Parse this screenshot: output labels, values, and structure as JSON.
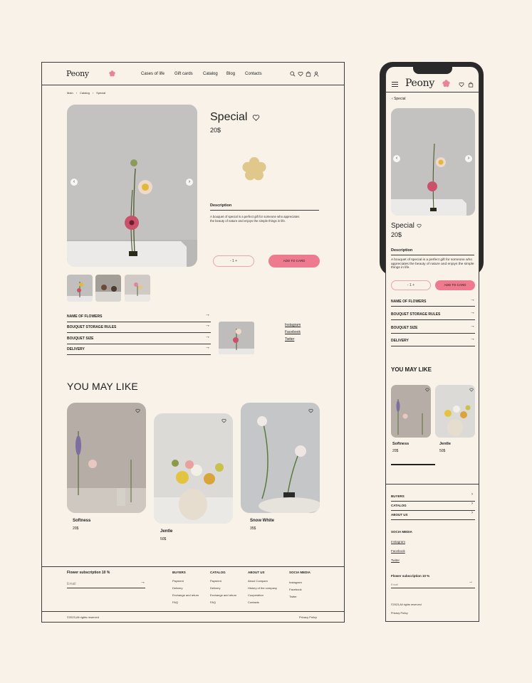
{
  "brand": {
    "name": "Peony",
    "accent": "#ee7a8f",
    "flower_color": "#e8849a",
    "bg": "#f8f2e8"
  },
  "nav": [
    "Cases of life",
    "Gift cards",
    "Catalog",
    "Blog",
    "Contacts"
  ],
  "header_icons": [
    "search-icon",
    "heart-icon",
    "bag-icon",
    "user-icon"
  ],
  "breadcrumbs": [
    "Main",
    "Catalog",
    "Special"
  ],
  "product": {
    "title": "Special",
    "price": "20$",
    "desc_heading": "Description",
    "description": "A bouquet of special is a perfect gift for someone who appreciates the beauty of nature and enjoys the simple things in life.",
    "qty": "- 1 +",
    "cart": "ADD TO CARD"
  },
  "accordion": [
    "NAME OF FLOWERS",
    "BOUQUET STORAGE RULES",
    "BOUQUET SIZE",
    "DELIVERY"
  ],
  "social": [
    "Instagram",
    "Facebook",
    "Twiter"
  ],
  "you_may_like": {
    "title": "YOU MAY LIKE",
    "items": [
      {
        "name": "Softness",
        "price": "20$"
      },
      {
        "name": "Jentle",
        "price": "50$"
      },
      {
        "name": "Snow White",
        "price": "35$"
      }
    ]
  },
  "footer": {
    "subscription": "Flower subscription 10 %",
    "email_placeholder": "Email",
    "cols": [
      {
        "title": "BUYERS",
        "items": [
          "Payment",
          "Delivery",
          "Exchange and return",
          "FAQ"
        ]
      },
      {
        "title": "CATALOG",
        "items": [
          "Payment",
          "Delivery",
          "Exchange and return",
          "FAQ"
        ]
      },
      {
        "title": "ABOUT US",
        "items": [
          "About Compam",
          "History of the company",
          "Cooperation",
          "Contacts"
        ]
      },
      {
        "title": "SOCIA MEDIA",
        "items": [
          "Instagram",
          "Facebook",
          "Twiter"
        ]
      }
    ],
    "copyright": "©2023,All rights reserved",
    "privacy": "Privacy Policy"
  },
  "mobile": {
    "back_label": "Special",
    "accordion": [
      "NAME OF FLOWERS",
      "BOUQUET STORAGE RULES",
      "BOUQUET SIZE",
      "DELIVERY"
    ],
    "cards": [
      {
        "name": "Softness",
        "price": "20$"
      },
      {
        "name": "Jentle",
        "price": "50$"
      }
    ],
    "foot_links": [
      "BUYERS",
      "CATALOG",
      "ABOUT US"
    ],
    "social_title": "SOCIA MEDIA",
    "social": [
      "Instagram",
      "Facebook",
      "Twiter"
    ],
    "subscription": "Flower subscription 10 %",
    "email_placeholder": "Email",
    "copyright": "©2023,All rights reserved",
    "privacy": "Privacy Policy"
  }
}
